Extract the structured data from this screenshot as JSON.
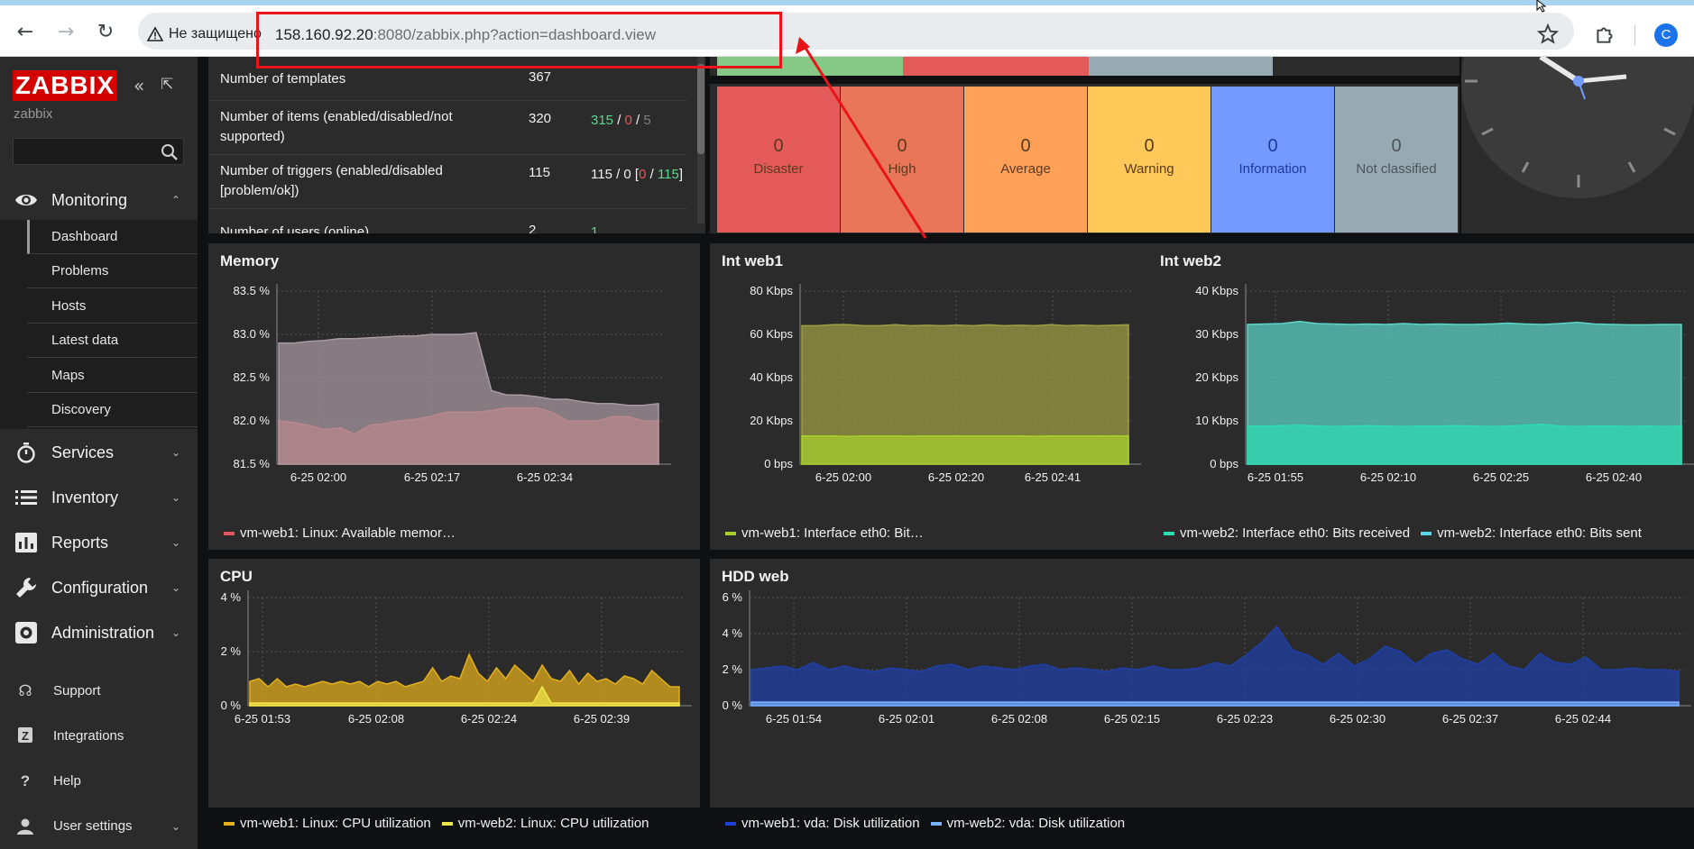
{
  "browser": {
    "security_label": "Не защищено",
    "url_host": "158.160.92.20",
    "url_rest": ":8080/zabbix.php?action=dashboard.view",
    "profile_letter": "C"
  },
  "sidebar": {
    "logo": "ZABBIX",
    "server_name": "zabbix",
    "search_placeholder": "",
    "monitoring": "Monitoring",
    "submenu": [
      "Dashboard",
      "Problems",
      "Hosts",
      "Latest data",
      "Maps",
      "Discovery"
    ],
    "sections": [
      "Services",
      "Inventory",
      "Reports",
      "Configuration",
      "Administration"
    ],
    "bottom": [
      "Support",
      "Integrations",
      "Help",
      "User settings"
    ]
  },
  "system_info": {
    "rows": [
      {
        "param": "Number of templates",
        "value": "367",
        "details": ""
      },
      {
        "param": "Number of items (enabled/disabled/not supported)",
        "value": "320",
        "d1": "315",
        "d2": "0",
        "d3": "5"
      },
      {
        "param": "Number of triggers (enabled/disabled [problem/ok])",
        "value": "115",
        "t1": "115 / 0 [",
        "t2": "0",
        "t3": "115",
        "t4": "]"
      },
      {
        "param": "Number of users (online)",
        "value": "2",
        "details": "1"
      }
    ]
  },
  "severity": [
    {
      "count": "0",
      "label": "Disaster",
      "color": "#e45959"
    },
    {
      "count": "0",
      "label": "High",
      "color": "#e97659"
    },
    {
      "count": "0",
      "label": "Average",
      "color": "#ffa059"
    },
    {
      "count": "0",
      "label": "Warning",
      "color": "#ffc859"
    },
    {
      "count": "0",
      "label": "Information",
      "color": "#7499ff"
    },
    {
      "count": "0",
      "label": "Not classified",
      "color": "#97aab3"
    }
  ],
  "graphs": {
    "memory": {
      "title": "Memory",
      "legend": "vm-web1: Linux: Available memor…"
    },
    "intweb1": {
      "title": "Int web1",
      "legend": "vm-web1: Interface eth0: Bit…"
    },
    "intweb2": {
      "title": "Int web2",
      "legend1": "vm-web2: Interface eth0: Bits received",
      "legend2": "vm-web2: Interface eth0: Bits sent"
    },
    "cpu": {
      "title": "CPU",
      "legend1": "vm-web1: Linux: CPU utilization",
      "legend2": "vm-web2: Linux: CPU utilization"
    },
    "hdd": {
      "title": "HDD web",
      "legend1": "vm-web1: vda: Disk utilization",
      "legend2": "vm-web2: vda: Disk utilization"
    }
  },
  "chart_data": [
    {
      "type": "area",
      "title": "Memory",
      "yticks": [
        "83.5 %",
        "83.0 %",
        "82.5 %",
        "82.0 %",
        "81.5 %"
      ],
      "xticks": [
        "6-25 02:00",
        "6-25 02:17",
        "6-25 02:34"
      ],
      "ylim": [
        81.5,
        83.5
      ],
      "series": [
        {
          "name": "vm-web1: Linux: Available memor…",
          "color": "#e45959",
          "values": [
            82.0,
            81.98,
            81.95,
            81.9,
            81.92,
            81.85,
            81.95,
            81.97,
            82.0,
            82.02,
            82.05,
            82.1,
            82.1,
            82.1,
            82.12,
            82.15,
            82.15,
            82.15,
            82.1,
            82.0,
            82.0,
            82.0,
            82.05,
            82.05,
            82.0,
            82.0
          ]
        },
        {
          "name": "",
          "color": "#a99aa1",
          "values": [
            82.9,
            82.9,
            82.92,
            82.93,
            82.95,
            82.95,
            82.96,
            82.97,
            82.98,
            82.98,
            83.0,
            83.0,
            83.0,
            83.02,
            82.35,
            82.3,
            82.3,
            82.28,
            82.25,
            82.25,
            82.22,
            82.2,
            82.2,
            82.18,
            82.18,
            82.2
          ]
        }
      ]
    },
    {
      "type": "area",
      "title": "Int web1",
      "yticks": [
        "80 Kbps",
        "60 Kbps",
        "40 Kbps",
        "20 Kbps",
        "0 bps"
      ],
      "xticks": [
        "6-25 02:00",
        "6-25 02:20",
        "6-25 02:41"
      ],
      "ylim": [
        0,
        80
      ],
      "series": [
        {
          "name": "",
          "color": "#9f9f45",
          "values": [
            64,
            64,
            64.5,
            64.5,
            64,
            64,
            64.5,
            64,
            64.2,
            64,
            64.3,
            64,
            64.4,
            64,
            64.2,
            64,
            64.5,
            64,
            64.3,
            64,
            64.2,
            64.4
          ]
        },
        {
          "name": "vm-web1: Interface eth0: Bit…",
          "color": "#a9cf2c",
          "values": [
            13,
            13,
            13,
            12.8,
            13,
            13,
            13,
            12.9,
            13,
            13,
            13.1,
            13,
            13,
            13,
            13,
            12.9,
            13,
            13,
            13,
            13,
            13.1,
            13
          ]
        }
      ]
    },
    {
      "type": "area",
      "title": "Int web2",
      "yticks": [
        "40 Kbps",
        "30 Kbps",
        "20 Kbps",
        "10 Kbps",
        "0 bps"
      ],
      "xticks": [
        "6-25 01:55",
        "6-25 02:10",
        "6-25 02:25",
        "6-25 02:40"
      ],
      "ylim": [
        0,
        40
      ],
      "series": [
        {
          "name": "vm-web2: Interface eth0: Bits sent",
          "color": "#5bd6c8",
          "values": [
            32.3,
            32.4,
            32.5,
            33,
            32.5,
            32.4,
            32.3,
            32.4,
            32.3,
            32.5,
            32.3,
            32.4,
            32.3,
            32.3,
            32.4,
            32.6,
            32.4,
            32.3,
            32.5,
            32.8,
            32.4,
            32.3,
            32.2,
            32.2,
            32.3,
            32.3
          ]
        },
        {
          "name": "vm-web2: Interface eth0: Bits received",
          "color": "#2fdbb1",
          "values": [
            8.8,
            8.8,
            8.9,
            9.0,
            8.8,
            8.7,
            8.8,
            8.9,
            8.8,
            8.7,
            8.8,
            8.8,
            8.9,
            8.8,
            8.7,
            8.8,
            9.0,
            9.2,
            8.8,
            8.7,
            8.8,
            8.8,
            8.7,
            8.8,
            8.7,
            8.8
          ]
        }
      ]
    },
    {
      "type": "area",
      "title": "CPU",
      "yticks": [
        "4 %",
        "2 %",
        "0 %"
      ],
      "xticks": [
        "6-25 01:53",
        "6-25 02:08",
        "6-25 02:24",
        "6-25 02:39"
      ],
      "ylim": [
        0,
        4
      ],
      "series": [
        {
          "name": "vm-web1: Linux: CPU utilization",
          "color": "#e5b01c",
          "values": [
            0.9,
            1.0,
            0.7,
            1.0,
            0.7,
            0.8,
            0.7,
            0.8,
            0.9,
            0.8,
            0.9,
            0.8,
            0.9,
            0.7,
            0.9,
            0.8,
            0.9,
            0.7,
            0.8,
            0.9,
            1.4,
            0.9,
            1.1,
            1.0,
            1.9,
            1.2,
            0.9,
            1.4,
            1.0,
            1.5,
            1.2,
            0.9,
            1.5,
            1.0,
            0.9,
            1.3,
            0.8,
            1.2,
            0.9,
            1.0,
            0.8,
            1.1,
            1.0,
            0.8,
            1.3,
            1.0,
            0.7,
            0.7
          ]
        },
        {
          "name": "vm-web2: Linux: CPU utilization",
          "color": "#f0e54a",
          "values": [
            0.1,
            0.1,
            0.1,
            0.1,
            0.1,
            0.1,
            0.1,
            0.1,
            0.1,
            0.1,
            0.1,
            0.1,
            0.1,
            0.1,
            0.1,
            0.1,
            0.1,
            0.1,
            0.1,
            0.1,
            0.1,
            0.1,
            0.1,
            0.1,
            0.1,
            0.1,
            0.1,
            0.1,
            0.1,
            0.1,
            0.1,
            0.1,
            0.7,
            0.1,
            0.1,
            0.1,
            0.1,
            0.1,
            0.1,
            0.1,
            0.1,
            0.1,
            0.1,
            0.1,
            0.1,
            0.1,
            0.1,
            0.1
          ]
        }
      ]
    },
    {
      "type": "area",
      "title": "HDD web",
      "yticks": [
        "6 %",
        "4 %",
        "2 %",
        "0 %"
      ],
      "xticks": [
        "6-25 01:54",
        "6-25 02:01",
        "6-25 02:08",
        "6-25 02:15",
        "6-25 02:23",
        "6-25 02:30",
        "6-25 02:37",
        "6-25 02:44"
      ],
      "ylim": [
        0,
        6
      ],
      "series": [
        {
          "name": "vm-web1: vda: Disk utilization",
          "color": "#1f3fa8",
          "values": [
            2.0,
            2.1,
            2.2,
            2.0,
            2.4,
            2.0,
            2.2,
            2.0,
            1.9,
            2.1,
            2.0,
            1.9,
            2.2,
            2.3,
            2.0,
            2.2,
            2.1,
            2.0,
            2.2,
            2.3,
            2.0,
            2.1,
            2.0,
            1.9,
            2.1,
            2.0,
            2.2,
            2.0,
            2.0,
            2.1,
            2.4,
            2.2,
            2.8,
            3.5,
            4.4,
            3.1,
            2.8,
            2.3,
            2.9,
            2.2,
            2.6,
            3.3,
            3.0,
            2.3,
            2.9,
            3.1,
            2.6,
            2.3,
            2.9,
            2.2,
            2.0,
            2.9,
            2.4,
            2.3,
            2.7,
            2.0,
            2.0,
            2.1,
            2.0,
            2.0,
            1.9
          ]
        },
        {
          "name": "vm-web2: vda: Disk utilization",
          "color": "#7bb0ff",
          "values": [
            0.2,
            0.2,
            0.2,
            0.2,
            0.2,
            0.2,
            0.2,
            0.2,
            0.2,
            0.2,
            0.2,
            0.2,
            0.2,
            0.2,
            0.2,
            0.2,
            0.2,
            0.2,
            0.2,
            0.2,
            0.2,
            0.2,
            0.2,
            0.2,
            0.2,
            0.2,
            0.2,
            0.2,
            0.2,
            0.2,
            0.2,
            0.2,
            0.2,
            0.2,
            0.2,
            0.2,
            0.2,
            0.2,
            0.2,
            0.2,
            0.2,
            0.2,
            0.2,
            0.2,
            0.2,
            0.2,
            0.2,
            0.2,
            0.2,
            0.2,
            0.2,
            0.2,
            0.2,
            0.2,
            0.2,
            0.2,
            0.2,
            0.2,
            0.2,
            0.2,
            0.2
          ]
        }
      ]
    }
  ]
}
